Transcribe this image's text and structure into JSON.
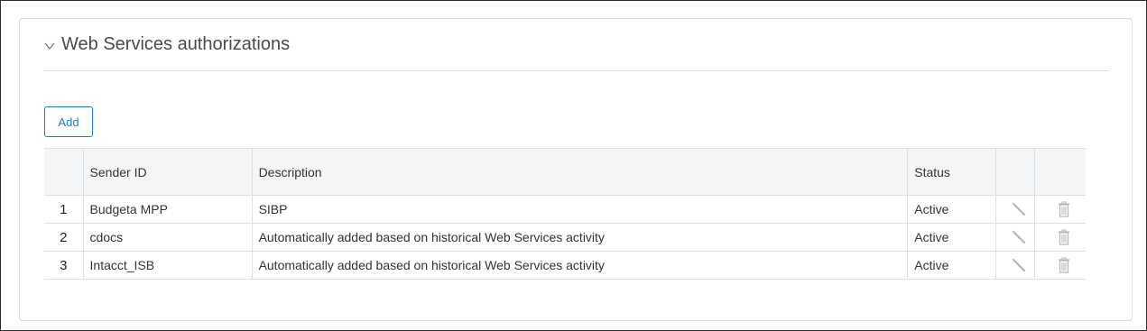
{
  "section": {
    "title": "Web Services authorizations"
  },
  "toolbar": {
    "add_label": "Add"
  },
  "table": {
    "columns": {
      "number": "",
      "sender_id": "Sender ID",
      "description": "Description",
      "status": "Status",
      "edit": "",
      "delete": ""
    },
    "rows": [
      {
        "number": "1",
        "sender_id": "Budgeta MPP",
        "description": "SIBP",
        "status": "Active"
      },
      {
        "number": "2",
        "sender_id": "cdocs",
        "description": "Automatically added based on historical Web Services activity",
        "status": "Active"
      },
      {
        "number": "3",
        "sender_id": "Intacct_ISB",
        "description": "Automatically added based on historical Web Services activity",
        "status": "Active"
      }
    ]
  },
  "icons": {
    "collapse": "chevron-down-icon",
    "edit": "pencil-icon",
    "delete": "trash-icon"
  },
  "colors": {
    "accent": "#1d7fbf",
    "header_bg": "#f4f5f6",
    "border": "#dcdfe3",
    "icon_gray": "#b5b5b5"
  }
}
